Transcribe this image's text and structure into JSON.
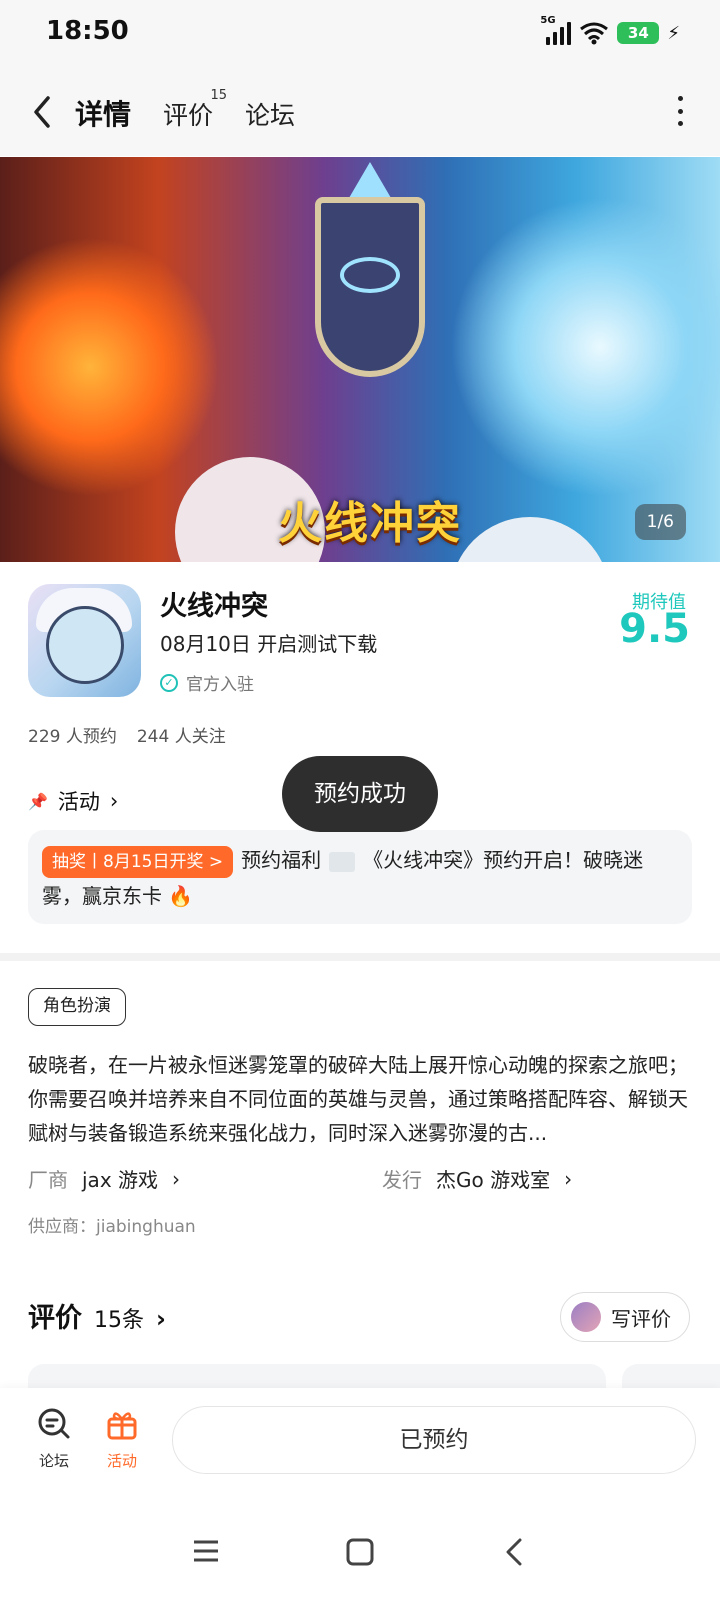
{
  "status": {
    "time": "18:50",
    "network": "5G",
    "battery": "34"
  },
  "nav": {
    "tabs": [
      {
        "label": "详情"
      },
      {
        "label": "评价",
        "badge": "15"
      },
      {
        "label": "论坛"
      }
    ]
  },
  "banner": {
    "logo_text": "火线冲突",
    "pager": "1/6"
  },
  "game": {
    "name": "火线冲突",
    "date_text": "08月10日 开启测试下载",
    "official": "官方入驻",
    "expect_label": "期待值",
    "expect_value": "9.5",
    "reservations": "229 人预约",
    "followers": "244 人关注"
  },
  "toast": "预约成功",
  "activity": {
    "heading": "活动",
    "tag": "抽奖丨8月15日开奖 >",
    "text_before_image": "预约福利",
    "text_after_image": "《火线冲突》预约开启！破晓迷雾，赢京东卡 🔥"
  },
  "genre": "角色扮演",
  "description": "破晓者，在一片被永恒迷雾笼罩的破碎大陆上展开惊心动魄的探索之旅吧；你需要召唤并培养来自不同位面的英雄与灵兽，通过策略搭配阵容、解锁天赋树与装备锻造系统来强化战力，同时深入迷雾弥漫的古...",
  "vendor": {
    "label": "厂商",
    "value": "jax 游戏"
  },
  "publisher": {
    "label": "发行",
    "value": "杰Go 游戏室"
  },
  "supplier": "供应商：jiabinghuan",
  "reviews": {
    "title": "评价",
    "count": "15条",
    "write": "写评价"
  },
  "bottombar": {
    "forum": "论坛",
    "activity": "活动",
    "reserved": "已预约"
  },
  "colors": {
    "accent": "#1fc8bc",
    "orange": "#ff6a2a"
  }
}
